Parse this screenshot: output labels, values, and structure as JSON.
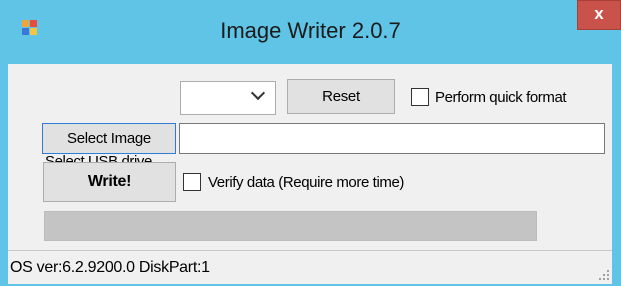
{
  "window": {
    "title": "Image Writer 2.0.7",
    "app_icon": "image-writer-icon",
    "close_glyph": "x"
  },
  "usb": {
    "label": "Select USB drive",
    "selected_value": "",
    "dropdown_icon": "chevron-down-icon"
  },
  "buttons": {
    "reset_label": "Reset",
    "select_image_label": "Select Image",
    "write_label": "Write!"
  },
  "options": {
    "quick_format_label": "Perform quick format",
    "quick_format_checked": false,
    "verify_label": "Verify data (Require more time)",
    "verify_checked": false
  },
  "image_path": {
    "value": ""
  },
  "progress": {
    "percent": 100
  },
  "status": {
    "text": "OS ver:6.2.9200.0 DiskPart:1"
  },
  "colors": {
    "titlebar": "#5fc4e6",
    "close_button": "#c9524a",
    "window_body": "#f0f0f0"
  }
}
